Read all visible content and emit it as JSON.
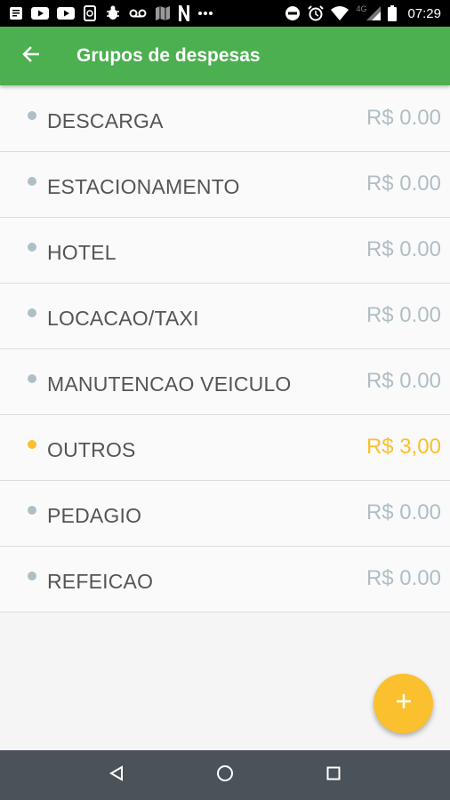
{
  "status_bar": {
    "time": "07:29",
    "network": "4G",
    "left_icons": [
      "message-icon",
      "youtube-icon",
      "youtube-icon",
      "whatsapp-icon",
      "bug-icon",
      "voicemail-icon",
      "map-icon",
      "netflix-icon",
      "more-icon"
    ],
    "right_icons": [
      "dnd-icon",
      "alarm-icon",
      "wifi-icon",
      "signal-icon",
      "battery-icon"
    ]
  },
  "app_bar": {
    "title": "Grupos de despesas",
    "back_icon": "arrow-left-icon",
    "color": "#4caf50"
  },
  "expense_groups": [
    {
      "name": "DESCARGA",
      "value": "R$ 0.00",
      "active": false
    },
    {
      "name": "ESTACIONAMENTO",
      "value": "R$ 0.00",
      "active": false
    },
    {
      "name": "HOTEL",
      "value": "R$ 0.00",
      "active": false
    },
    {
      "name": "LOCACAO/TAXI",
      "value": "R$ 0.00",
      "active": false
    },
    {
      "name": "MANUTENCAO VEICULO",
      "value": "R$ 0.00",
      "active": false
    },
    {
      "name": "OUTROS",
      "value": "R$ 3,00",
      "active": true
    },
    {
      "name": "PEDAGIO",
      "value": "R$ 0.00",
      "active": false
    },
    {
      "name": "REFEICAO",
      "value": "R$ 0.00",
      "active": false
    }
  ],
  "colors": {
    "inactive": "#b0bec5",
    "active": "#fbc02d",
    "fab": "#fbc02d"
  },
  "fab": {
    "icon": "plus-icon"
  },
  "nav_bar": {
    "icons": [
      "back-triangle-icon",
      "home-circle-icon",
      "recents-square-icon"
    ]
  }
}
